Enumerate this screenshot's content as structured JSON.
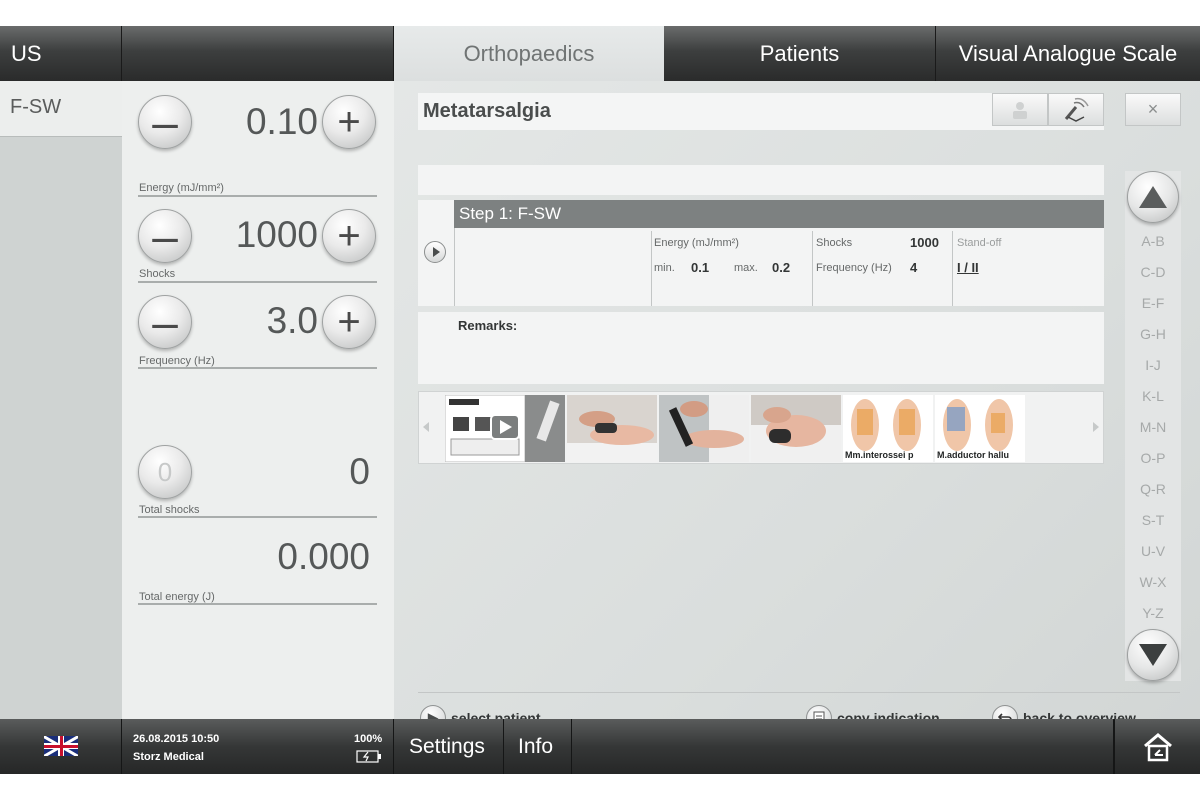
{
  "top_tabs": {
    "left": "US",
    "orthopaedics": "Orthopaedics",
    "patients": "Patients",
    "vas": "Visual Analogue Scale"
  },
  "left_tab": "F-SW",
  "params": {
    "energy": {
      "value": "0.10",
      "label": "Energy (mJ/mm²)"
    },
    "shocks": {
      "value": "1000",
      "label": "Shocks"
    },
    "frequency": {
      "value": "3.0",
      "label": "Frequency (Hz)"
    },
    "total_shocks": {
      "value": "0",
      "label": "Total shocks",
      "reset_label": "0"
    },
    "total_energy": {
      "value": "0.000",
      "label": "Total energy (J)"
    },
    "minus": "–",
    "plus": "+"
  },
  "indication": {
    "title": "Metatarsalgia",
    "close": "×",
    "step_title": "Step 1:  F-SW",
    "energy_label": "Energy (mJ/mm²)",
    "min_label": "min.",
    "min_value": "0.1",
    "max_label": "max.",
    "max_value": "0.2",
    "shocks_label": "Shocks",
    "shocks_value": "1000",
    "freq_label": "Frequency (Hz)",
    "freq_value": "4",
    "standoff_label": "Stand-off",
    "standoff_value": "I / II",
    "remarks_label": "Remarks:",
    "thumb_captions": [
      "Mm.interossei p",
      "M.adductor hallu"
    ]
  },
  "alphabet": [
    "A-B",
    "C-D",
    "E-F",
    "G-H",
    "I-J",
    "K-L",
    "M-N",
    "O-P",
    "Q-R",
    "S-T",
    "U-V",
    "W-X",
    "Y-Z"
  ],
  "actions": {
    "select_patient": "select patient",
    "copy_indication": "copy indication",
    "back_to_overview": "back to overview"
  },
  "footer": {
    "datetime": "26.08.2015 10:50",
    "company": "Storz Medical",
    "battery": "100%",
    "settings": "Settings",
    "info": "Info"
  }
}
